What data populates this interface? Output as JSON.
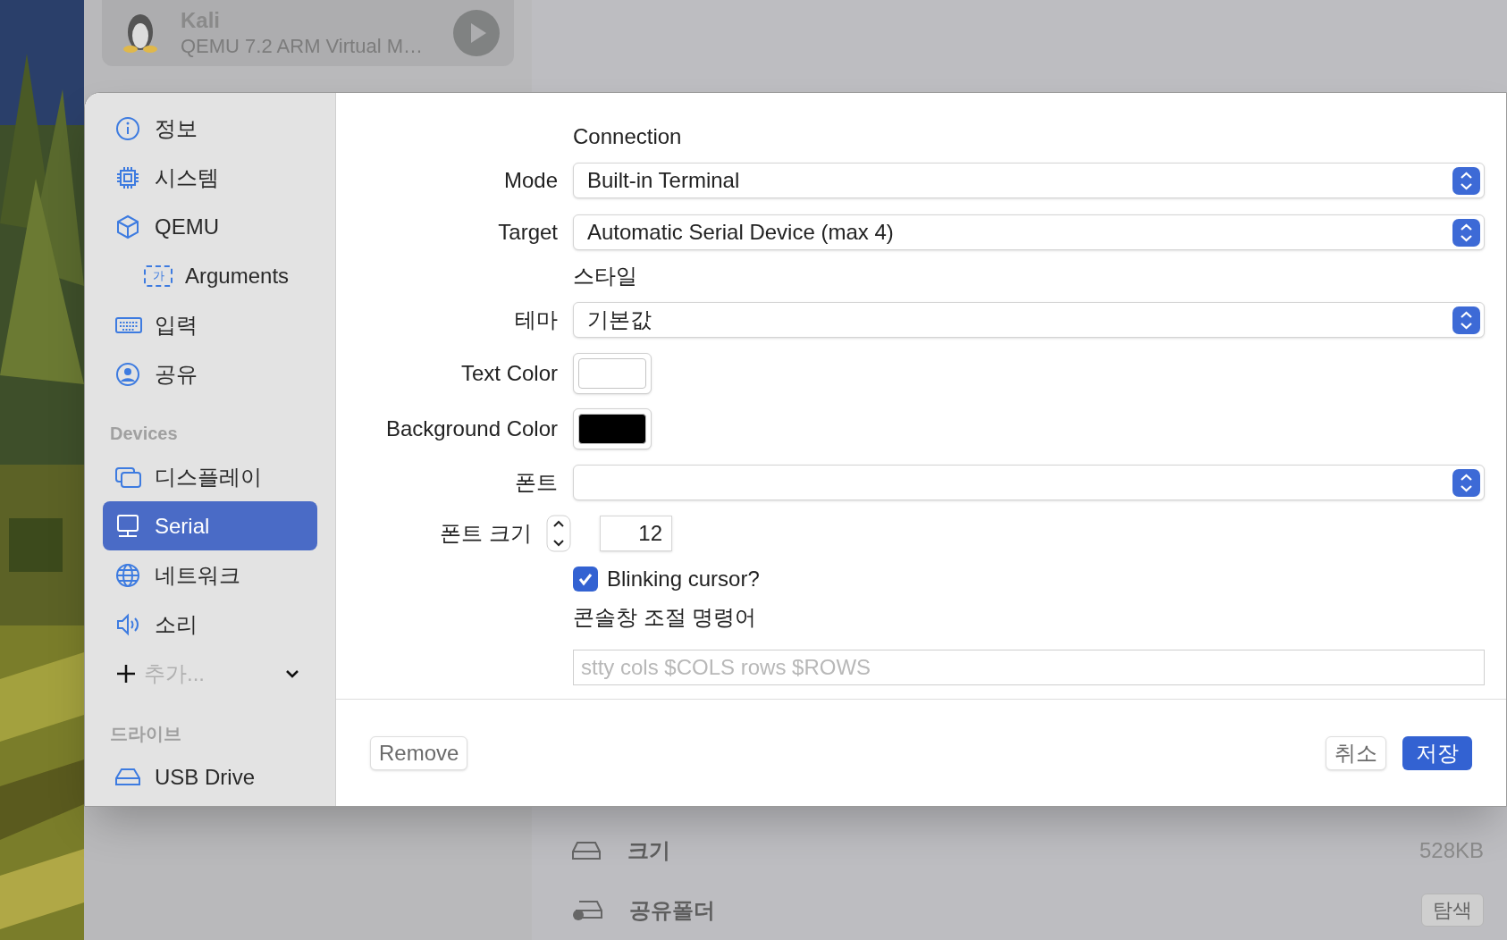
{
  "vm_list": [
    {
      "name": "Kali",
      "subtitle": "QEMU 7.2 ARM Virtual M…"
    }
  ],
  "details": [
    {
      "kind": "text",
      "label": "크기",
      "value": "528KB"
    },
    {
      "kind": "button",
      "label": "공유폴더",
      "value": "탐색"
    }
  ],
  "sidebar": [
    {
      "items": [
        {
          "label": "정보",
          "selected": false
        },
        {
          "label": "시스템",
          "selected": false
        },
        {
          "label": "QEMU",
          "selected": false,
          "children": [
            {
              "label": "Arguments",
              "tag": "가",
              "selected": false
            }
          ]
        },
        {
          "label": "입력",
          "selected": false
        },
        {
          "label": "공유",
          "selected": false
        }
      ]
    },
    {
      "header": "Devices",
      "items": [
        {
          "label": "디스플레이",
          "selected": false
        },
        {
          "label": "Serial",
          "selected": true
        },
        {
          "label": "네트워크",
          "selected": false
        },
        {
          "label": "소리",
          "selected": false
        }
      ],
      "add": "추가..."
    },
    {
      "header": "드라이브",
      "items": [
        {
          "label": "USB Drive",
          "selected": false
        }
      ]
    }
  ],
  "form": [
    {
      "kind": "heading",
      "text": "Connection"
    },
    {
      "kind": "popup",
      "label": "Mode",
      "value": "Built-in Terminal"
    },
    {
      "kind": "popup",
      "label": "Target",
      "value": "Automatic Serial Device (max 4)"
    },
    {
      "kind": "heading",
      "text": "스타일"
    },
    {
      "kind": "popup",
      "label": "테마",
      "value": "기본값"
    },
    {
      "kind": "color",
      "label": "Text Color",
      "color": "#ffffff"
    },
    {
      "kind": "color",
      "label": "Background Color",
      "color": "#000000"
    },
    {
      "kind": "popup",
      "label": "폰트"
    },
    {
      "kind": "stepper",
      "label": "폰트 크기",
      "value": "12"
    },
    {
      "kind": "checkbox",
      "label": "Blinking cursor?",
      "checked": true
    },
    {
      "kind": "heading",
      "text": "콘솔창 조절 명령어"
    },
    {
      "kind": "text",
      "placeholder": "stty cols $COLS rows $ROWS"
    }
  ],
  "footer": {
    "remove": "Remove",
    "cancel": "취소",
    "save": "저장"
  }
}
